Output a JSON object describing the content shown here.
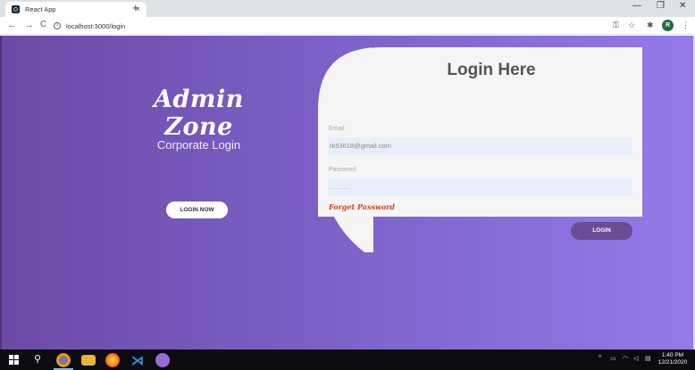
{
  "browser": {
    "tab_title": "React App",
    "tab_close": "×",
    "new_tab": "+",
    "minimize": "—",
    "restore": "❐",
    "close": "✕",
    "back": "←",
    "forward": "→",
    "reload": "C",
    "info_icon": "i",
    "url": "localhost:3000/login",
    "profile_initial": "R"
  },
  "hero": {
    "title": "Admin Zone",
    "subtitle": "Corporate Login",
    "button_label": "LOGIN NOW"
  },
  "login": {
    "title": "Login Here",
    "email_label": "Email",
    "email_value": "rk53618@gmail.com",
    "password_label": "Password",
    "password_value": "........",
    "forgot_label": "Forget Password",
    "submit_label": "LOGIN"
  },
  "taskbar": {
    "time": "1:40 PM",
    "date": "12/21/2020"
  },
  "colors": {
    "gradient_start": "#6b4aa6",
    "gradient_end": "#9479e9",
    "accent_button": "#6a4d95",
    "forgot_link": "#e0411c"
  }
}
